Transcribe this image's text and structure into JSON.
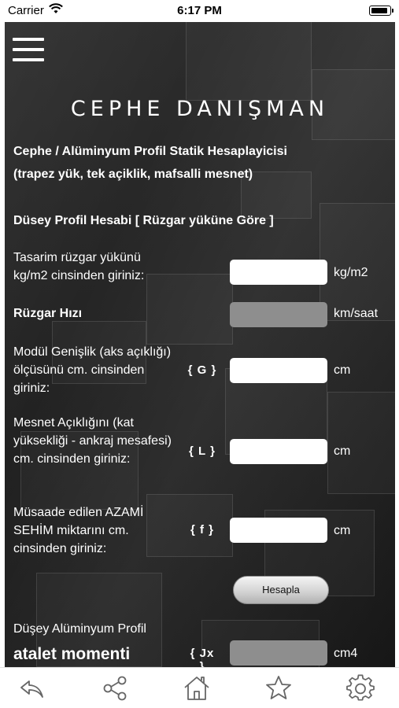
{
  "status_bar": {
    "carrier": "Carrier",
    "time": "6:17 PM"
  },
  "brand": "CEPHE DANIŞMAN",
  "title_line1": "Cephe / Alüminyum Profil Statik Hesaplayicisi",
  "title_line2": "(trapez yük, tek açiklik, mafsalli mesnet)",
  "section_title": "Düsey Profil Hesabi [ Rüzgar yüküne Göre ]",
  "fields": {
    "wind_load": {
      "label": "Tasarim rüzgar yükünü kg/m2 cinsinden giriniz:",
      "value": "",
      "unit": "kg/m2"
    },
    "wind_speed": {
      "label": "Rüzgar Hızı",
      "value": "",
      "unit": "km/saat"
    },
    "module_width": {
      "label": "Modül Genişlik (aks açıklığı) ölçüsünü cm. cinsinden giriniz:",
      "symbol": "{ G }",
      "value": "",
      "unit": "cm"
    },
    "support_span": {
      "label": "Mesnet Açıklığını (kat yüksekliği - ankraj mesafesi) cm. cinsinden giriniz:",
      "symbol": "{ L }",
      "value": "",
      "unit": "cm"
    },
    "max_deflection": {
      "label": "Müsaade edilen AZAMİ SEHİM miktarını cm. cinsinden giriniz:",
      "symbol": "{ f }",
      "value": "",
      "unit": "cm"
    }
  },
  "calculate_button": "Hesapla",
  "inertia": {
    "line1": "Düşey Alüminyum Profil",
    "line2": "atalet momenti",
    "symbol": "{ Jx }",
    "value": "",
    "unit": "cm4"
  },
  "tabs": [
    "back-icon",
    "share-icon",
    "home-icon",
    "star-icon",
    "gear-icon"
  ]
}
